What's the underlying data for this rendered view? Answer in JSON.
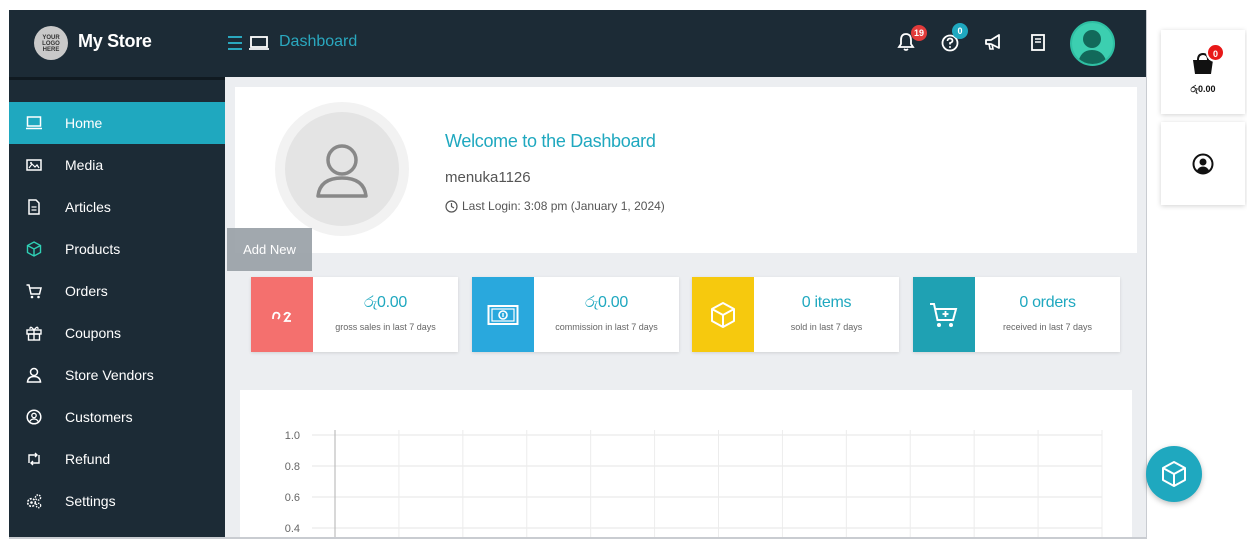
{
  "header": {
    "logo_text": "YOUR LOGO HERE",
    "store_name": "My Store",
    "breadcrumb": "Dashboard",
    "notifications_count": "19",
    "help_count": "0"
  },
  "sidebar": {
    "items": [
      {
        "label": "Home",
        "icon": "monitor-icon",
        "active": true
      },
      {
        "label": "Media",
        "icon": "image-icon"
      },
      {
        "label": "Articles",
        "icon": "document-icon"
      },
      {
        "label": "Products",
        "icon": "cube-icon"
      },
      {
        "label": "Orders",
        "icon": "cart-icon"
      },
      {
        "label": "Coupons",
        "icon": "gift-icon"
      },
      {
        "label": "Store Vendors",
        "icon": "user-icon"
      },
      {
        "label": "Customers",
        "icon": "user-circle-icon"
      },
      {
        "label": "Refund",
        "icon": "retweet-icon"
      },
      {
        "label": "Settings",
        "icon": "gears-icon"
      }
    ]
  },
  "welcome": {
    "title": "Welcome to the Dashboard",
    "username": "menuka1126",
    "last_login": "Last Login: 3:08 pm (January 1, 2024)"
  },
  "tooltip": {
    "add_new": "Add New"
  },
  "stats": [
    {
      "value": "රු0.00",
      "label": "gross sales in last 7 days",
      "color": "#f4706e",
      "icon": "rupee-icon"
    },
    {
      "value": "රු0.00",
      "label": "commission in last 7 days",
      "color": "#29a8dd",
      "icon": "money-icon"
    },
    {
      "value": "0 items",
      "label": "sold in last 7 days",
      "color": "#f6c90e",
      "icon": "cube-icon"
    },
    {
      "value": "0 orders",
      "label": "received in last 7 days",
      "color": "#1fa1b3",
      "icon": "cart-plus-icon"
    }
  ],
  "chart_data": {
    "type": "line",
    "y_ticks": [
      "1.0",
      "0.8",
      "0.6",
      "0.4"
    ],
    "ylim": [
      0,
      1
    ],
    "grid": true
  },
  "cart_widget": {
    "count": "0",
    "total": "රු0.00"
  },
  "colors": {
    "topbar": "#1c2b36",
    "accent": "#1fa8bf",
    "badge_red": "#e23b3b",
    "badge_teal": "#1fa8bf"
  }
}
